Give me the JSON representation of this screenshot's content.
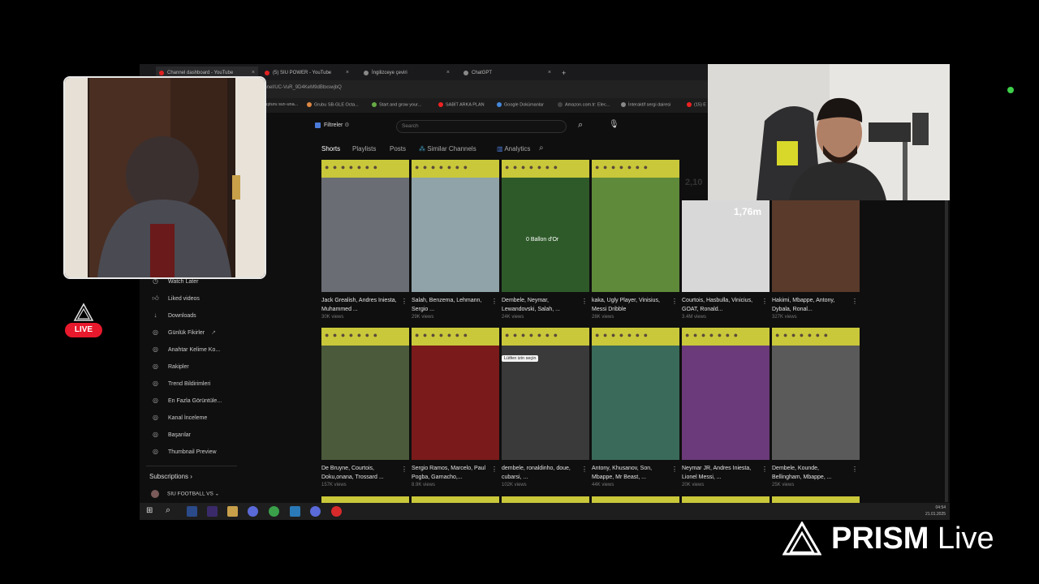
{
  "tabs": [
    {
      "title": "Channel dashboard - YouTube",
      "color": "#e02020"
    },
    {
      "title": "(5) SIU POWER - YouTube",
      "color": "#e02020"
    },
    {
      "title": "İngilizceye çeviri",
      "color": "#888"
    },
    {
      "title": "ChatGPT",
      "color": "#888"
    }
  ],
  "new_tab_label": "+",
  "url": "annel/UC-VuR_9D4KeM9dBbxswjbQ",
  "bookmarks": [
    {
      "label": "oluşturu sızı-una...",
      "color": "#888"
    },
    {
      "label": "Grubu SB-GLE Octa...",
      "color": "#d84"
    },
    {
      "label": "Start and grow your...",
      "color": "#6a4"
    },
    {
      "label": "SABİT ARKA PLAN",
      "color": "#e22"
    },
    {
      "label": "Google Dokümanlar",
      "color": "#48d"
    },
    {
      "label": "Amazon.com.tr: Elec...",
      "color": "#444"
    },
    {
      "label": "İnteraktif sergi dairesi",
      "color": "#888"
    },
    {
      "label": "(15) E",
      "color": "#e22"
    }
  ],
  "filter": {
    "label": "Filtreler",
    "search_placeholder": "Search"
  },
  "content_tabs": [
    "Shorts",
    "Playlists",
    "Posts",
    "Similar Channels",
    "Analytics"
  ],
  "sidebar": {
    "items": [
      "Watch Later",
      "Liked videos",
      "Downloads",
      "Günlük Fikirler",
      "Anahtar Kelime Ko...",
      "Rakipler",
      "Trend Bildirimleri",
      "En Fazla Görüntüle...",
      "Kanal İnceleme",
      "Başarılar",
      "Thumbnail Preview"
    ],
    "subscriptions_label": "Subscriptions",
    "subscription_item": "SIU FOOTBALL VS"
  },
  "videos": [
    {
      "title": "Jack Grealish, Andres Iniesta, Muhammed ...",
      "views": "30K views",
      "photo": "#6a6e74"
    },
    {
      "title": "Salah, Benzema, Lehmann, Sergio ...",
      "views": "29K views",
      "photo": "#8fa3a8"
    },
    {
      "title": "Dembele, Neymar, Lewandovski, Salah, ...",
      "views": "24K views",
      "photo": "#2e5a2a"
    },
    {
      "title": "kaka, Ugly Player, Vinisius, Messi Dribble",
      "views": "28K views",
      "photo": "#5f8a3a"
    },
    {
      "title": "Courtois, Hasbulla, Vinicius, GOAT, Ronald...",
      "views": "3.4M views",
      "photo": "#d8d8d8"
    },
    {
      "title": "Hakimi, Mbappe, Antony, Dybala, Ronal...",
      "views": "327K views",
      "photo": "#5a3a2a"
    },
    {
      "title": "De Bruyne, Courtois, Doku,onana, Trossard ...",
      "views": "157K views",
      "photo": "#4a5a3a"
    },
    {
      "title": "Sergio Ramos, Marcelo, Paul Pogba, Garnacho,...",
      "views": "8.9K views",
      "photo": "#7a1a1a"
    },
    {
      "title": "dembele, ronaldinho, doue, cubarsi, ...",
      "views": "102K views",
      "photo": "#3a3a3a"
    },
    {
      "title": "Antony, Khusanov, Son, Mbappe, Mr Beast, ...",
      "views": "44K views",
      "photo": "#3a6a5a"
    },
    {
      "title": "Neymar JR, Andres Iniesta, Lionel Messi, ...",
      "views": "20K views",
      "photo": "#6a3a7a"
    },
    {
      "title": "Dembele, Kounde, Bellingham, Mbappe, ...",
      "views": "25K views",
      "photo": "#5a5a5a"
    }
  ],
  "overlays": {
    "ballon": "0 Ballon d'Or",
    "height": "1,76m",
    "num": "2,10"
  },
  "tooltip": "Lütfen izin seçin",
  "clock": {
    "time": "04:54",
    "date": "21.01.2025"
  },
  "live_label": "LIVE",
  "prism": {
    "bold": "PRISM",
    "light": "Live"
  }
}
